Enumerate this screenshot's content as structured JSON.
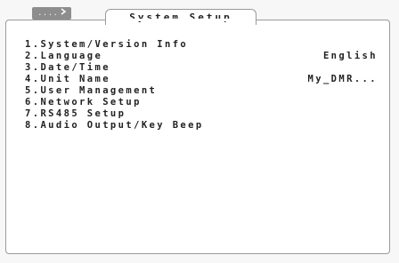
{
  "header": {
    "title": "System Setup",
    "back_button": {
      "dots": "....",
      "icon": "arrow-right-icon"
    }
  },
  "menu": {
    "items": [
      {
        "label": "1.System/Version Info",
        "value": ""
      },
      {
        "label": "2.Language",
        "value": "English"
      },
      {
        "label": "3.Date/Time",
        "value": ""
      },
      {
        "label": "4.Unit Name",
        "value": "My_DMR..."
      },
      {
        "label": "5.User Management",
        "value": ""
      },
      {
        "label": "6.Network Setup",
        "value": ""
      },
      {
        "label": "7.RS485 Setup",
        "value": ""
      },
      {
        "label": "8.Audio Output/Key Beep",
        "value": ""
      }
    ]
  }
}
